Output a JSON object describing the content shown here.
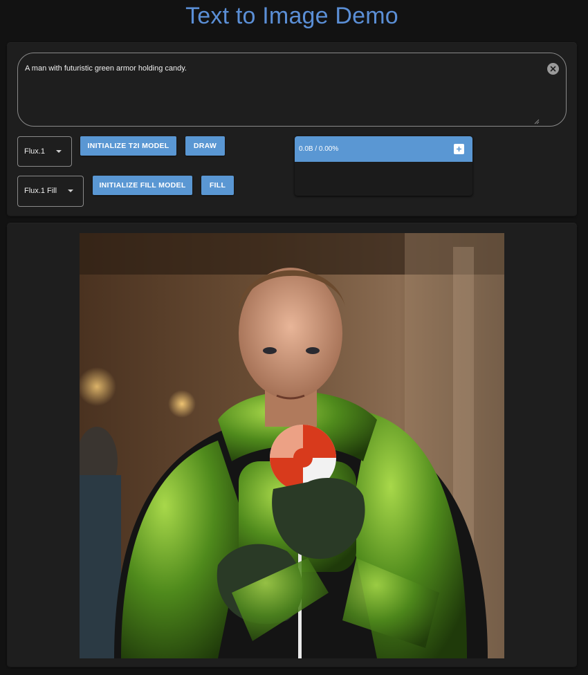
{
  "header": {
    "title": "Text to Image Demo"
  },
  "prompt": {
    "value": "A man with futuristic green armor holding candy."
  },
  "t2i": {
    "model_select": "Flux.1",
    "init_button": "INITIALIZE T2I MODEL",
    "draw_button": "DRAW"
  },
  "fill": {
    "model_select": "Flux.1 Fill",
    "init_button": "INITIALIZE FILL MODEL",
    "fill_button": "FILL"
  },
  "progress": {
    "text": "0.0B / 0.00%"
  },
  "colors": {
    "accent": "#5a97d3",
    "title": "#5b8fd6",
    "panel": "#1e1e1e",
    "background": "#121212"
  },
  "icons": [
    "clear-icon",
    "chevron-down-icon",
    "plus-icon"
  ],
  "output_image": {
    "alt": "Generated image"
  }
}
